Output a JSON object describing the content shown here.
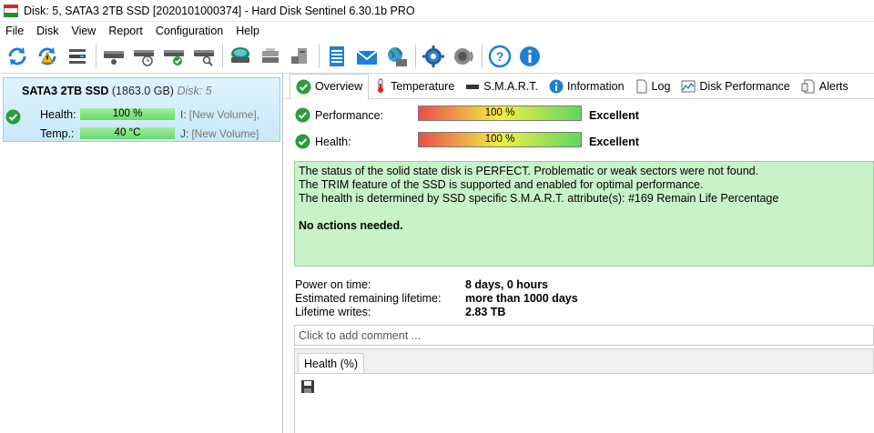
{
  "window": {
    "title": "Disk: 5, SATA3 2TB SSD [2020101000374]  -  Hard Disk Sentinel 6.30.1b PRO"
  },
  "menu": [
    "File",
    "Disk",
    "View",
    "Report",
    "Configuration",
    "Help"
  ],
  "toolbar": {
    "buttons": [
      "refresh-icon",
      "refresh-warning-icon",
      "disk-list-icon",
      "disk-icon",
      "disk-clock-icon",
      "disk-check-icon",
      "disk-search-icon",
      "scan-icon",
      "disk-stack-icon",
      "disk-network-icon",
      "notepad-icon",
      "mail-icon",
      "globe-icon",
      "gear-icon",
      "speaker-icon",
      "help-icon",
      "info-icon"
    ]
  },
  "disk": {
    "name": "SATA3 2TB SSD",
    "size": "(1863.0 GB)",
    "disk_label": "Disk: 5",
    "health_label": "Health:",
    "health_value": "100 %",
    "temp_label": "Temp.:",
    "temp_value": "40 °C",
    "volume1_letter": "I:",
    "volume1_name": "[New Volume],",
    "volume2_letter": "J:",
    "volume2_name": "[New Volume]"
  },
  "tabs": [
    {
      "label": "Overview",
      "icon": "check-icon"
    },
    {
      "label": "Temperature",
      "icon": "thermometer-icon"
    },
    {
      "label": "S.M.A.R.T.",
      "icon": "drive-icon"
    },
    {
      "label": "Information",
      "icon": "info-icon"
    },
    {
      "label": "Log",
      "icon": "document-icon"
    },
    {
      "label": "Disk Performance",
      "icon": "chart-icon"
    },
    {
      "label": "Alerts",
      "icon": "alert-list-icon"
    }
  ],
  "overview": {
    "performance_label": "Performance:",
    "performance_percent": 100,
    "performance_value": "100 %",
    "performance_rating": "Excellent",
    "health_label": "Health:",
    "health_percent": 100,
    "health_value": "100 %",
    "health_rating": "Excellent",
    "status_lines": [
      "The status of the solid state disk is PERFECT. Problematic or weak sectors were not found.",
      "The TRIM feature of the SSD is supported and enabled for optimal performance.",
      "The health is determined by SSD specific S.M.A.R.T. attribute(s):  #169 Remain Life Percentage"
    ],
    "status_action": "No actions needed.",
    "power_on_label": "Power on time:",
    "power_on_value": "8 days, 0 hours",
    "lifetime_label": "Estimated remaining lifetime:",
    "lifetime_value": "more than 1000 days",
    "writes_label": "Lifetime writes:",
    "writes_value": "2.83 TB",
    "comment_placeholder": "Click to add comment ...",
    "graph_tab": "Health (%)"
  },
  "colors": {
    "selection_bg": "#c9e8fa",
    "ok_green": "#2a9d3a",
    "status_bg": "#c8f3c8"
  }
}
